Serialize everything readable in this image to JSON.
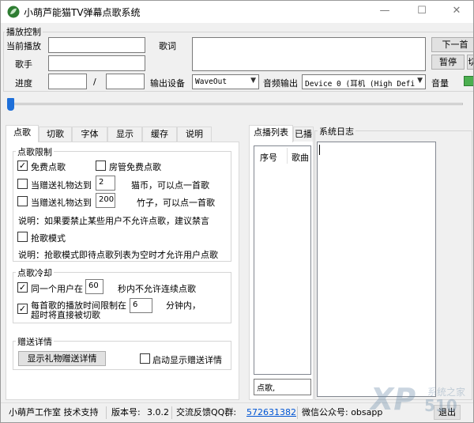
{
  "window": {
    "title": "小萌芦能猫TV弹幕点歌系统",
    "minimize": "—",
    "maximize": "☐",
    "close": "✕"
  },
  "playback": {
    "group_title": "播放控制",
    "current_label": "当前播放",
    "singer_label": "歌手",
    "progress_label": "进度",
    "slash": "/",
    "lyrics_label": "歌词",
    "output_device_label": "输出设备",
    "output_device_value": "WaveOut",
    "audio_output_label": "音频输出",
    "audio_output_value": "Device 0 (耳机 (High Defi",
    "volume_label": "音量",
    "next_button": "下一首",
    "pause_button": "暂停",
    "second_right_button": "切"
  },
  "tabs": [
    "点歌",
    "切歌",
    "字体",
    "显示",
    "缓存",
    "说明"
  ],
  "song_limit": {
    "title": "点歌限制",
    "free_song": "免费点歌",
    "room_admin_free": "房管免费点歌",
    "gift_cat_label": "当赠送礼物达到",
    "gift_cat_value": "2",
    "gift_cat_suffix": "猫币，可以点一首歌",
    "gift_bamboo_label": "当赠送礼物达到",
    "gift_bamboo_value": "200",
    "gift_bamboo_suffix": "竹子，可以点一首歌",
    "note1": "说明：如果要禁止某些用户不允许点歌，建议禁言",
    "grab_mode": "抢歌模式",
    "note2": "说明：抢歌模式即待点歌列表为空时才允许用户点歌"
  },
  "cooldown": {
    "title": "点歌冷却",
    "same_user_label": "同一个用户在",
    "same_user_value": "60",
    "same_user_suffix": "秒内不允许连续点歌",
    "time_limit_label": "每首歌的播放时间限制在",
    "time_limit_label2": "超时将直接被切歌",
    "time_limit_value": "6",
    "time_limit_suffix": "分钟内，"
  },
  "gift_details": {
    "title": "赠送详情",
    "show_button": "显示礼物赠送详情",
    "auto_show": "启动显示赠送详情"
  },
  "playlist": {
    "tab_active": "点播列表",
    "tab_other": "已播",
    "col_index": "序号",
    "col_song": "歌曲",
    "input_value": "点歌,"
  },
  "log": {
    "title": "系统日志"
  },
  "statusbar": {
    "studio": "小萌芦工作室 技术支持",
    "version_label": "版本号:",
    "version_value": "3.0.2",
    "feedback_label": "交流反馈QQ群:",
    "feedback_value": "572631382",
    "wechat_label": "微信公众号: obsapp",
    "exit_button": "退出"
  },
  "watermark": {
    "brand": "XP",
    "site_cn": "系统之家",
    "site_num": "510"
  },
  "colors": {
    "accent_blue": "#1e6fd9",
    "link": "#0055d4",
    "green": "#4caf50"
  }
}
